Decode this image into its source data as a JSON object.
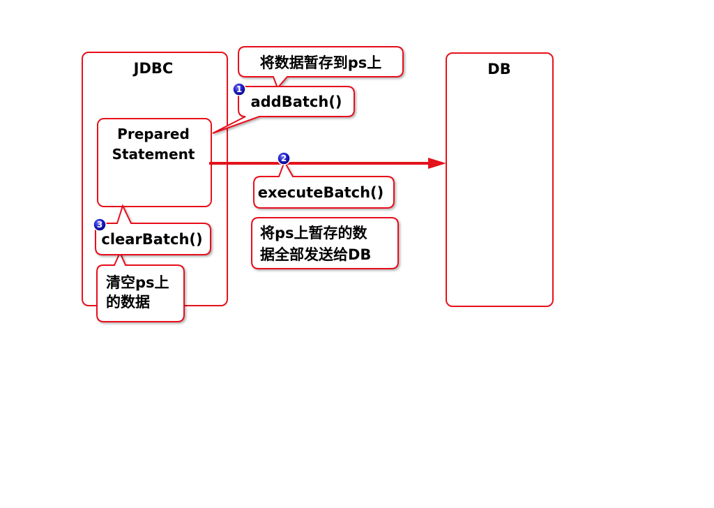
{
  "jdbc_panel": {
    "title": "JDBC"
  },
  "db_panel": {
    "title": "DB"
  },
  "prepared_statement": {
    "line1": "Prepared",
    "line2": "Statement"
  },
  "callouts": {
    "store_note": "将数据暂存到ps上",
    "add_batch": "addBatch()",
    "execute_batch": "executeBatch()",
    "send_note_line1": "将ps上暂存的数",
    "send_note_line2": "据全部发送给DB",
    "clear_batch": "clearBatch()",
    "clear_note_line1": "清空ps上",
    "clear_note_line2": "的数据"
  },
  "steps": [
    "1",
    "2",
    "3"
  ],
  "colors": {
    "outline": "#e8101a",
    "arrow": "#e3121b",
    "badge": "#1616b8"
  }
}
